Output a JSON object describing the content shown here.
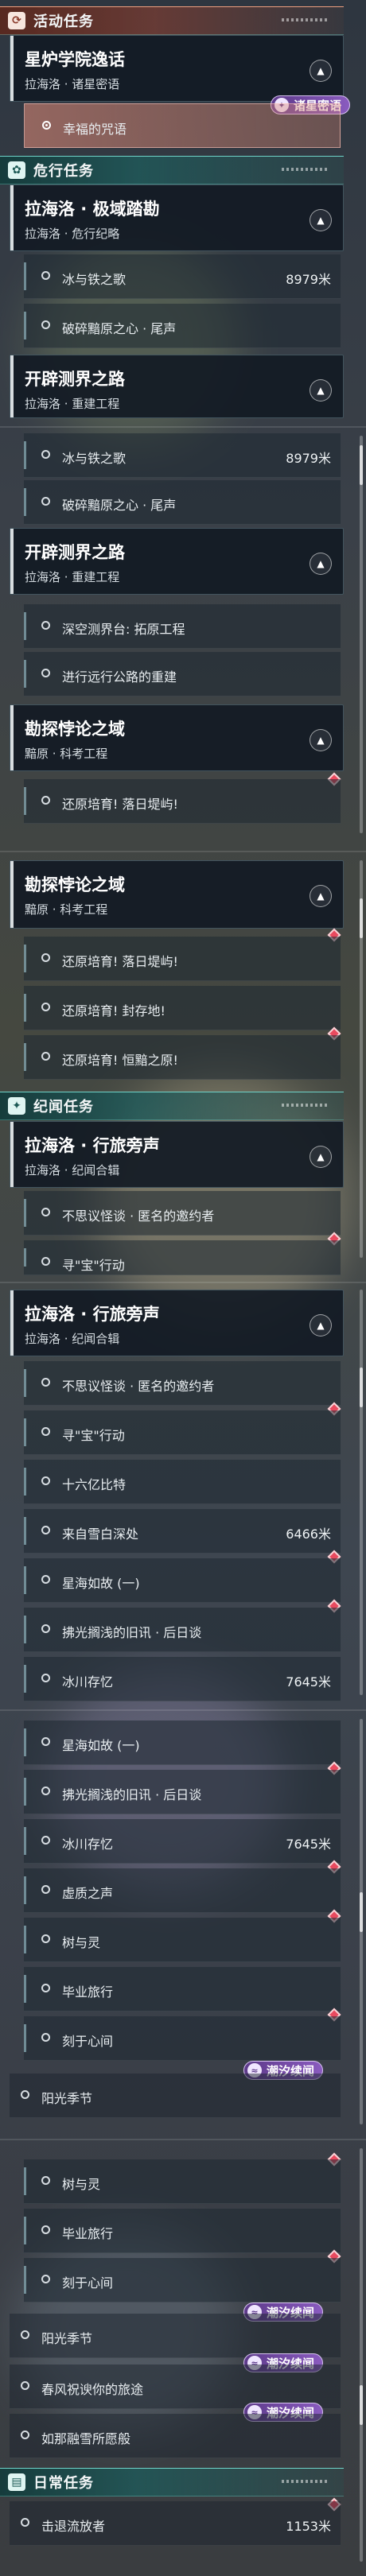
{
  "sections": {
    "activity": "活动任务",
    "crisis": "危行任务",
    "chronicle": "纪闻任务",
    "daily": "日常任务"
  },
  "quests": {
    "starforge": {
      "title": "星炉学院逸话",
      "sub": "拉海洛 · 诸星密语"
    },
    "extreme": {
      "title": "拉海洛 · 极域踏勘",
      "sub": "拉海洛 · 危行纪略"
    },
    "pioneer": {
      "title": "开辟测界之路",
      "sub": "拉海洛 · 重建工程"
    },
    "explore": {
      "title": "勘探悖论之域",
      "sub": "黯原 · 科考工程"
    },
    "travel": {
      "title": "拉海洛 · 行旅旁声",
      "sub": "拉海洛 · 纪闻合辑"
    }
  },
  "tasks": {
    "lucky": "幸福的咒语",
    "iceiron": "冰与铁之歌",
    "shatter": "破碎黯原之心 · 尾声",
    "deepbase": "深空测界台: 拓原工程",
    "highway": "进行远行公路的重建",
    "restore1": "还原培育! 落日堤屿!",
    "restore2": "还原培育! 封存地!",
    "restore3": "还原培育! 恒黯之原!",
    "strange": "不思议怪谈 · 匿名的邀约者",
    "seek": "寻\"宝\"行动",
    "sixteen": "十六亿比特",
    "abyss": "来自雪白深处",
    "sea": "星海如故 (一)",
    "old": "拂光搁浅的旧讯 · 后日谈",
    "glacier": "冰川存忆",
    "void": "虚质之声",
    "tree": "树与灵",
    "graduate": "毕业旅行",
    "engrave": "刻于心间",
    "sunshine": "阳光季节",
    "spring": "春风祝谀你的旅途",
    "mouse": "如那融雪所愿般",
    "strike": "击退流放者"
  },
  "dist": {
    "d8979": "8979米",
    "d6466": "6466米",
    "d7645": "7645米",
    "d1153": "1153米"
  },
  "tags": {
    "stars": "诸星密语",
    "tide": "潮汐续闻"
  },
  "icons": {
    "activity": "spiral-icon",
    "crisis": "flower-icon",
    "chronicle": "sparkle-icon",
    "daily": "book-icon"
  },
  "colors": {
    "marker": "#e84a5f",
    "tag": "#8a5bbf",
    "selected": "#d98a78"
  }
}
